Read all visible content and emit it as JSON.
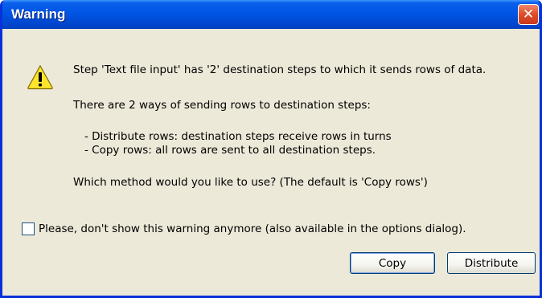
{
  "window": {
    "title": "Warning",
    "close_glyph": "✕"
  },
  "message": {
    "line1": "Step 'Text file input' has '2' destination steps to which it sends rows of data.",
    "line2": "There are 2 ways of sending rows to destination steps:",
    "bullet1": "- Distribute rows: destination steps receive rows in turns",
    "bullet2": "- Copy rows: all rows are sent to all destination steps.",
    "question": "Which method would you like to use? (The default is 'Copy rows')"
  },
  "checkbox": {
    "label": "Please, don't show this warning anymore (also available in the options dialog).",
    "checked": false
  },
  "buttons": {
    "copy": "Copy",
    "distribute": "Distribute"
  },
  "icons": {
    "warning": "warning-icon",
    "close": "close-icon"
  },
  "colors": {
    "titlebar": "#0055e5",
    "dialog_bg": "#ece9d8",
    "close": "#e0502e",
    "warning_yellow": "#ffe42e"
  }
}
